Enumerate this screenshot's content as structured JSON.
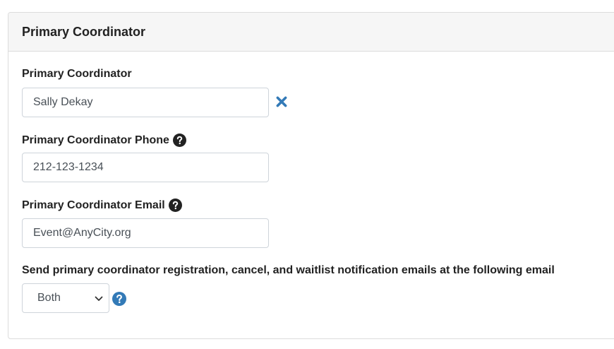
{
  "panel": {
    "title": "Primary Coordinator"
  },
  "coordinator": {
    "label": "Primary Coordinator",
    "value": "Sally Dekay"
  },
  "phone": {
    "label": "Primary Coordinator Phone",
    "value": "212-123-1234"
  },
  "email": {
    "label": "Primary Coordinator Email",
    "value": "Event@AnyCity.org"
  },
  "notification": {
    "label": "Send primary coordinator registration, cancel, and waitlist notification emails at the following email",
    "selected": "Both"
  },
  "icons": {
    "clear": "close-icon",
    "help": "question-circle-icon",
    "dropdown": "chevron-down-icon"
  },
  "colors": {
    "accent": "#337ab7",
    "help_dark": "#222222"
  }
}
